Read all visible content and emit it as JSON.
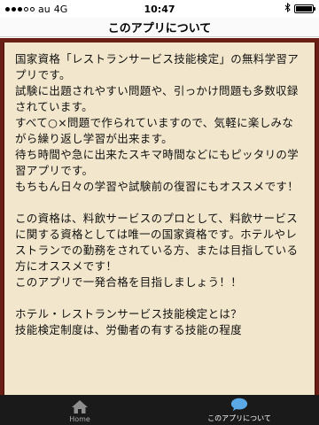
{
  "status": {
    "carrier": "au",
    "network": "4G",
    "time": "10:47"
  },
  "nav": {
    "title": "このアプリについて"
  },
  "content": {
    "paragraphs": [
      "国家資格「レストランサービス技能検定」の無料学習アプリです。\n試験に出題されやすい問題や、引っかけ問題も多数収録されています。\nすべて○×問題で作られていますので、気軽に楽しみながら繰り返し学習が出来ます。\n待ち時間や急に出来たスキマ時間などにもピッタリの学習アプリです。\nもちもん日々の学習や試験前の復習にもオススメです！",
      "この資格は、料飲サービスのプロとして、料飲サービスに関する資格としては唯一の国家資格です。ホテルやレストランでの勤務をされている方、または目指している方にオススメです！\nこのアプリで一発合格を目指しましょう！！",
      "ホテル・レストランサービス技能検定とは？\n技能検定制度は、労働者の有する技能の程度"
    ]
  },
  "tabs": [
    {
      "label": "Home",
      "icon": "home-icon"
    },
    {
      "label": "このアプリについて",
      "icon": "speech-bubble-icon"
    }
  ],
  "colors": {
    "frame": "#6b1e14",
    "paper": "#f2e7cc",
    "tab_bar": "#1a1a1a",
    "active_icon": "#5aa9e6"
  }
}
